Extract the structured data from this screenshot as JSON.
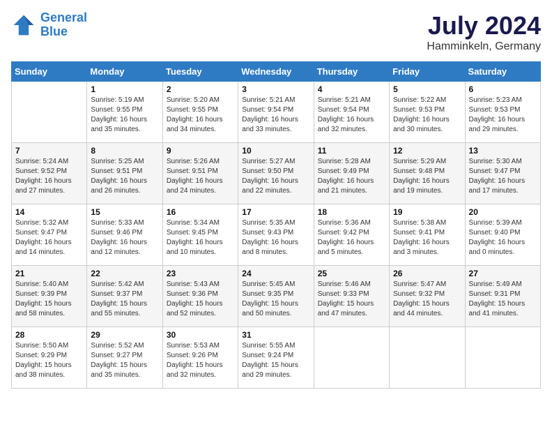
{
  "header": {
    "logo_line1": "General",
    "logo_line2": "Blue",
    "title": "July 2024",
    "location": "Hamminkeln, Germany"
  },
  "columns": [
    "Sunday",
    "Monday",
    "Tuesday",
    "Wednesday",
    "Thursday",
    "Friday",
    "Saturday"
  ],
  "weeks": [
    [
      {
        "day": "",
        "info": ""
      },
      {
        "day": "1",
        "info": "Sunrise: 5:19 AM\nSunset: 9:55 PM\nDaylight: 16 hours\nand 35 minutes."
      },
      {
        "day": "2",
        "info": "Sunrise: 5:20 AM\nSunset: 9:55 PM\nDaylight: 16 hours\nand 34 minutes."
      },
      {
        "day": "3",
        "info": "Sunrise: 5:21 AM\nSunset: 9:54 PM\nDaylight: 16 hours\nand 33 minutes."
      },
      {
        "day": "4",
        "info": "Sunrise: 5:21 AM\nSunset: 9:54 PM\nDaylight: 16 hours\nand 32 minutes."
      },
      {
        "day": "5",
        "info": "Sunrise: 5:22 AM\nSunset: 9:53 PM\nDaylight: 16 hours\nand 30 minutes."
      },
      {
        "day": "6",
        "info": "Sunrise: 5:23 AM\nSunset: 9:53 PM\nDaylight: 16 hours\nand 29 minutes."
      }
    ],
    [
      {
        "day": "7",
        "info": "Sunrise: 5:24 AM\nSunset: 9:52 PM\nDaylight: 16 hours\nand 27 minutes."
      },
      {
        "day": "8",
        "info": "Sunrise: 5:25 AM\nSunset: 9:51 PM\nDaylight: 16 hours\nand 26 minutes."
      },
      {
        "day": "9",
        "info": "Sunrise: 5:26 AM\nSunset: 9:51 PM\nDaylight: 16 hours\nand 24 minutes."
      },
      {
        "day": "10",
        "info": "Sunrise: 5:27 AM\nSunset: 9:50 PM\nDaylight: 16 hours\nand 22 minutes."
      },
      {
        "day": "11",
        "info": "Sunrise: 5:28 AM\nSunset: 9:49 PM\nDaylight: 16 hours\nand 21 minutes."
      },
      {
        "day": "12",
        "info": "Sunrise: 5:29 AM\nSunset: 9:48 PM\nDaylight: 16 hours\nand 19 minutes."
      },
      {
        "day": "13",
        "info": "Sunrise: 5:30 AM\nSunset: 9:47 PM\nDaylight: 16 hours\nand 17 minutes."
      }
    ],
    [
      {
        "day": "14",
        "info": "Sunrise: 5:32 AM\nSunset: 9:47 PM\nDaylight: 16 hours\nand 14 minutes."
      },
      {
        "day": "15",
        "info": "Sunrise: 5:33 AM\nSunset: 9:46 PM\nDaylight: 16 hours\nand 12 minutes."
      },
      {
        "day": "16",
        "info": "Sunrise: 5:34 AM\nSunset: 9:45 PM\nDaylight: 16 hours\nand 10 minutes."
      },
      {
        "day": "17",
        "info": "Sunrise: 5:35 AM\nSunset: 9:43 PM\nDaylight: 16 hours\nand 8 minutes."
      },
      {
        "day": "18",
        "info": "Sunrise: 5:36 AM\nSunset: 9:42 PM\nDaylight: 16 hours\nand 5 minutes."
      },
      {
        "day": "19",
        "info": "Sunrise: 5:38 AM\nSunset: 9:41 PM\nDaylight: 16 hours\nand 3 minutes."
      },
      {
        "day": "20",
        "info": "Sunrise: 5:39 AM\nSunset: 9:40 PM\nDaylight: 16 hours\nand 0 minutes."
      }
    ],
    [
      {
        "day": "21",
        "info": "Sunrise: 5:40 AM\nSunset: 9:39 PM\nDaylight: 15 hours\nand 58 minutes."
      },
      {
        "day": "22",
        "info": "Sunrise: 5:42 AM\nSunset: 9:37 PM\nDaylight: 15 hours\nand 55 minutes."
      },
      {
        "day": "23",
        "info": "Sunrise: 5:43 AM\nSunset: 9:36 PM\nDaylight: 15 hours\nand 52 minutes."
      },
      {
        "day": "24",
        "info": "Sunrise: 5:45 AM\nSunset: 9:35 PM\nDaylight: 15 hours\nand 50 minutes."
      },
      {
        "day": "25",
        "info": "Sunrise: 5:46 AM\nSunset: 9:33 PM\nDaylight: 15 hours\nand 47 minutes."
      },
      {
        "day": "26",
        "info": "Sunrise: 5:47 AM\nSunset: 9:32 PM\nDaylight: 15 hours\nand 44 minutes."
      },
      {
        "day": "27",
        "info": "Sunrise: 5:49 AM\nSunset: 9:31 PM\nDaylight: 15 hours\nand 41 minutes."
      }
    ],
    [
      {
        "day": "28",
        "info": "Sunrise: 5:50 AM\nSunset: 9:29 PM\nDaylight: 15 hours\nand 38 minutes."
      },
      {
        "day": "29",
        "info": "Sunrise: 5:52 AM\nSunset: 9:27 PM\nDaylight: 15 hours\nand 35 minutes."
      },
      {
        "day": "30",
        "info": "Sunrise: 5:53 AM\nSunset: 9:26 PM\nDaylight: 15 hours\nand 32 minutes."
      },
      {
        "day": "31",
        "info": "Sunrise: 5:55 AM\nSunset: 9:24 PM\nDaylight: 15 hours\nand 29 minutes."
      },
      {
        "day": "",
        "info": ""
      },
      {
        "day": "",
        "info": ""
      },
      {
        "day": "",
        "info": ""
      }
    ]
  ]
}
